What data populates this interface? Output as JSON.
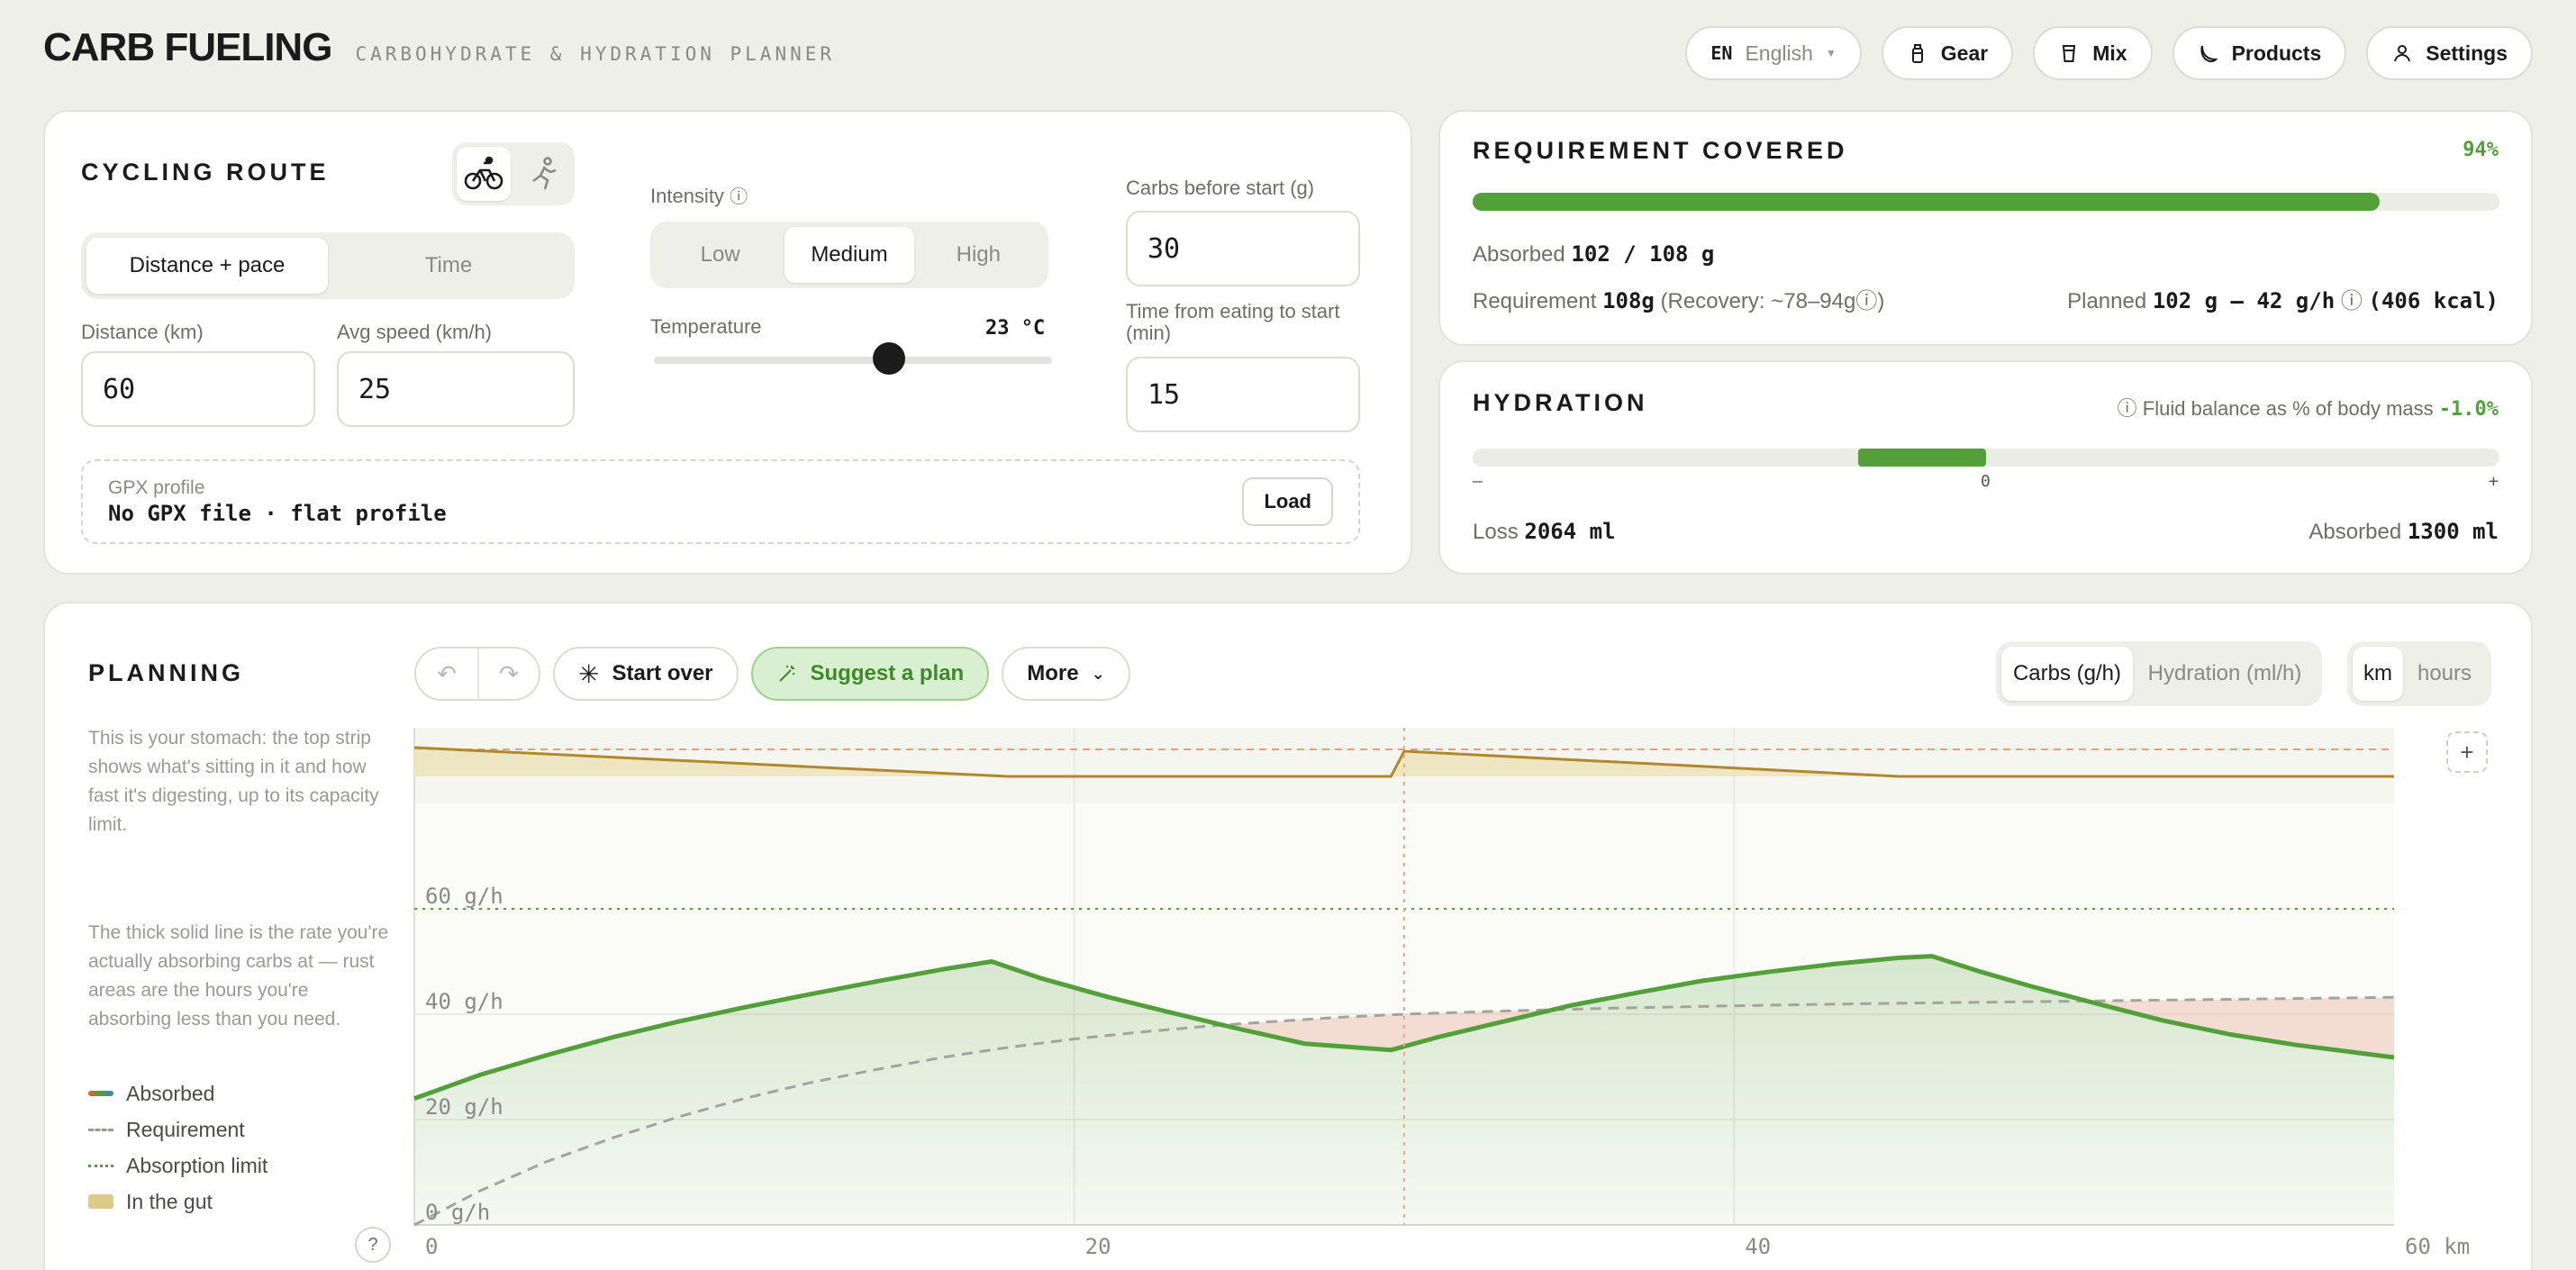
{
  "header": {
    "title": "CARB FUELING",
    "subtitle": "CARBOHYDRATE & HYDRATION PLANNER",
    "language": {
      "code": "EN",
      "label": "English"
    },
    "nav": [
      {
        "label": "Gear",
        "icon": "bottle-icon"
      },
      {
        "label": "Mix",
        "icon": "cup-icon"
      },
      {
        "label": "Products",
        "icon": "banana-icon"
      },
      {
        "label": "Settings",
        "icon": "user-icon"
      }
    ]
  },
  "route": {
    "title": "CYCLING ROUTE",
    "mode_options": [
      "Distance + pace",
      "Time"
    ],
    "mode_selected": "Distance + pace",
    "distance_label": "Distance (km)",
    "distance_value": "60",
    "speed_label": "Avg speed (km/h)",
    "speed_value": "25",
    "intensity_label": "Intensity",
    "intensity_options": [
      "Low",
      "Medium",
      "High"
    ],
    "intensity_selected": "Medium",
    "temperature_label": "Temperature",
    "temperature_value": "23 °C",
    "temperature_level": 0.59,
    "carbs_before_label": "Carbs before start (g)",
    "carbs_before_value": "30",
    "time_eating_label": "Time from eating to start (min)",
    "time_eating_value": "15",
    "gpx_label": "GPX profile",
    "gpx_value": "No GPX file · flat profile",
    "gpx_button": "Load"
  },
  "requirement": {
    "title": "REQUIREMENT COVERED",
    "percent": "94%",
    "fraction": 0.94,
    "absorbed_label": "Absorbed",
    "absorbed_value": "102 / 108 g",
    "requirement_label": "Requirement",
    "requirement_value": "108g",
    "recovery_text": "(Recovery: ~78–94g",
    "planned_label": "Planned",
    "planned_value": "102 g – 42 g/h",
    "kcal": "(406 kcal)",
    "accent_color": "#53a03a"
  },
  "hydration": {
    "title": "HYDRATION",
    "balance_label": "Fluid balance as % of body mass",
    "balance_value": "-1.0%",
    "balance_level": -0.25,
    "scale_min": "–",
    "scale_zero": "0",
    "scale_max": "+",
    "loss_label": "Loss",
    "loss_value": "2064 ml",
    "absorbed_label": "Absorbed",
    "absorbed_value": "1300 ml"
  },
  "planning": {
    "title": "PLANNING",
    "start_over": "Start over",
    "suggest": "Suggest a plan",
    "more": "More",
    "metric_options": [
      "Carbs (g/h)",
      "Hydration (ml/h)"
    ],
    "metric_selected": "Carbs (g/h)",
    "unit_options": [
      "km",
      "hours"
    ],
    "unit_selected": "km",
    "desc1": "This is your stomach: the top strip shows what's sitting in it and how fast it's digesting, up to its capacity limit.",
    "desc2": "The thick solid line is the rate you're actually absorbing carbs at — rust areas are the hours you're absorbing less than you need.",
    "legend": [
      {
        "label": "Absorbed",
        "icon": "absorbed-line"
      },
      {
        "label": "Requirement",
        "icon": "dashed-line"
      },
      {
        "label": "Absorption limit",
        "icon": "dotted-line"
      },
      {
        "label": "In the gut",
        "icon": "gut-swatch"
      }
    ],
    "help": "?",
    "add": "+"
  },
  "chart_data": {
    "type": "line",
    "x_unit": "km",
    "xlim": [
      0,
      60
    ],
    "ylim": [
      0,
      80
    ],
    "x_ticks": [
      "0",
      "20",
      "40",
      "60 km"
    ],
    "y_ticks": [
      "0 g/h",
      "20 g/h",
      "40 g/h",
      "60 g/h"
    ],
    "absorption_limit": 60,
    "marker_x": 30,
    "series": [
      {
        "name": "Absorbed",
        "x": [
          0,
          2,
          4,
          6,
          8,
          10,
          12,
          14,
          16,
          17.5,
          19,
          21,
          23,
          25,
          27,
          29.6,
          31,
          33,
          35,
          37,
          39,
          41,
          43,
          45,
          46,
          47.5,
          49,
          51,
          53,
          55,
          57,
          60
        ],
        "y": [
          24,
          28.5,
          32.2,
          35.6,
          38.6,
          41.3,
          43.8,
          46.2,
          48.5,
          50,
          46.8,
          43.3,
          40.2,
          37.2,
          34.4,
          33.2,
          35.6,
          38.6,
          41.6,
          44,
          46.3,
          48,
          49.5,
          50.7,
          51,
          48,
          45.3,
          42,
          38.8,
          36.2,
          34.2,
          31.8
        ]
      },
      {
        "name": "Requirement",
        "x": [
          0,
          2,
          4,
          6,
          8,
          10,
          12,
          14,
          16,
          18,
          20,
          22,
          24,
          26,
          28,
          30,
          33,
          36,
          40,
          44,
          48,
          52,
          56,
          60
        ],
        "y": [
          0,
          6.5,
          12,
          16.5,
          20.5,
          24,
          27,
          29.5,
          31.8,
          33.7,
          35.3,
          36.6,
          37.7,
          38.6,
          39.4,
          40,
          40.6,
          41.1,
          41.6,
          42,
          42.3,
          42.6,
          42.9,
          43.2
        ]
      }
    ],
    "gut": {
      "name": "In the gut",
      "x": [
        0,
        18,
        29.6,
        30,
        45,
        60
      ],
      "y": [
        0.4,
        0,
        0,
        0.35,
        0,
        0
      ]
    }
  }
}
